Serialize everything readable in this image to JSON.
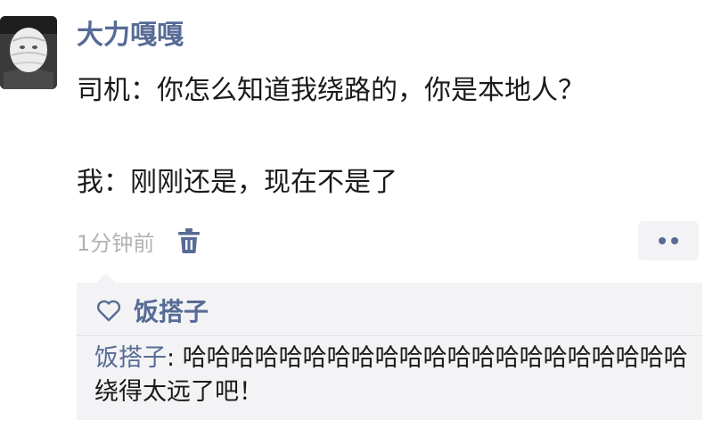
{
  "post": {
    "author": "大力嘎嘎",
    "lines": [
      "司机：你怎么知道我绕路的，你是本地人？",
      "我：刚刚还是，现在不是了"
    ],
    "timestamp": "1分钟前"
  },
  "icons": {
    "delete": "trash-icon",
    "more": "more-dots-icon",
    "like": "heart-outline-icon"
  },
  "likes": {
    "names": "饭搭子"
  },
  "comments": [
    {
      "author": "饭搭子",
      "separator": ": ",
      "text": "哈哈哈哈哈哈哈哈哈哈哈哈哈哈哈哈哈哈哈哈哈绕得太远了吧！"
    }
  ],
  "colors": {
    "link": "#576b95",
    "text": "#1a1a1a",
    "muted": "#b2b2b2",
    "panel": "#f3f3f5"
  }
}
